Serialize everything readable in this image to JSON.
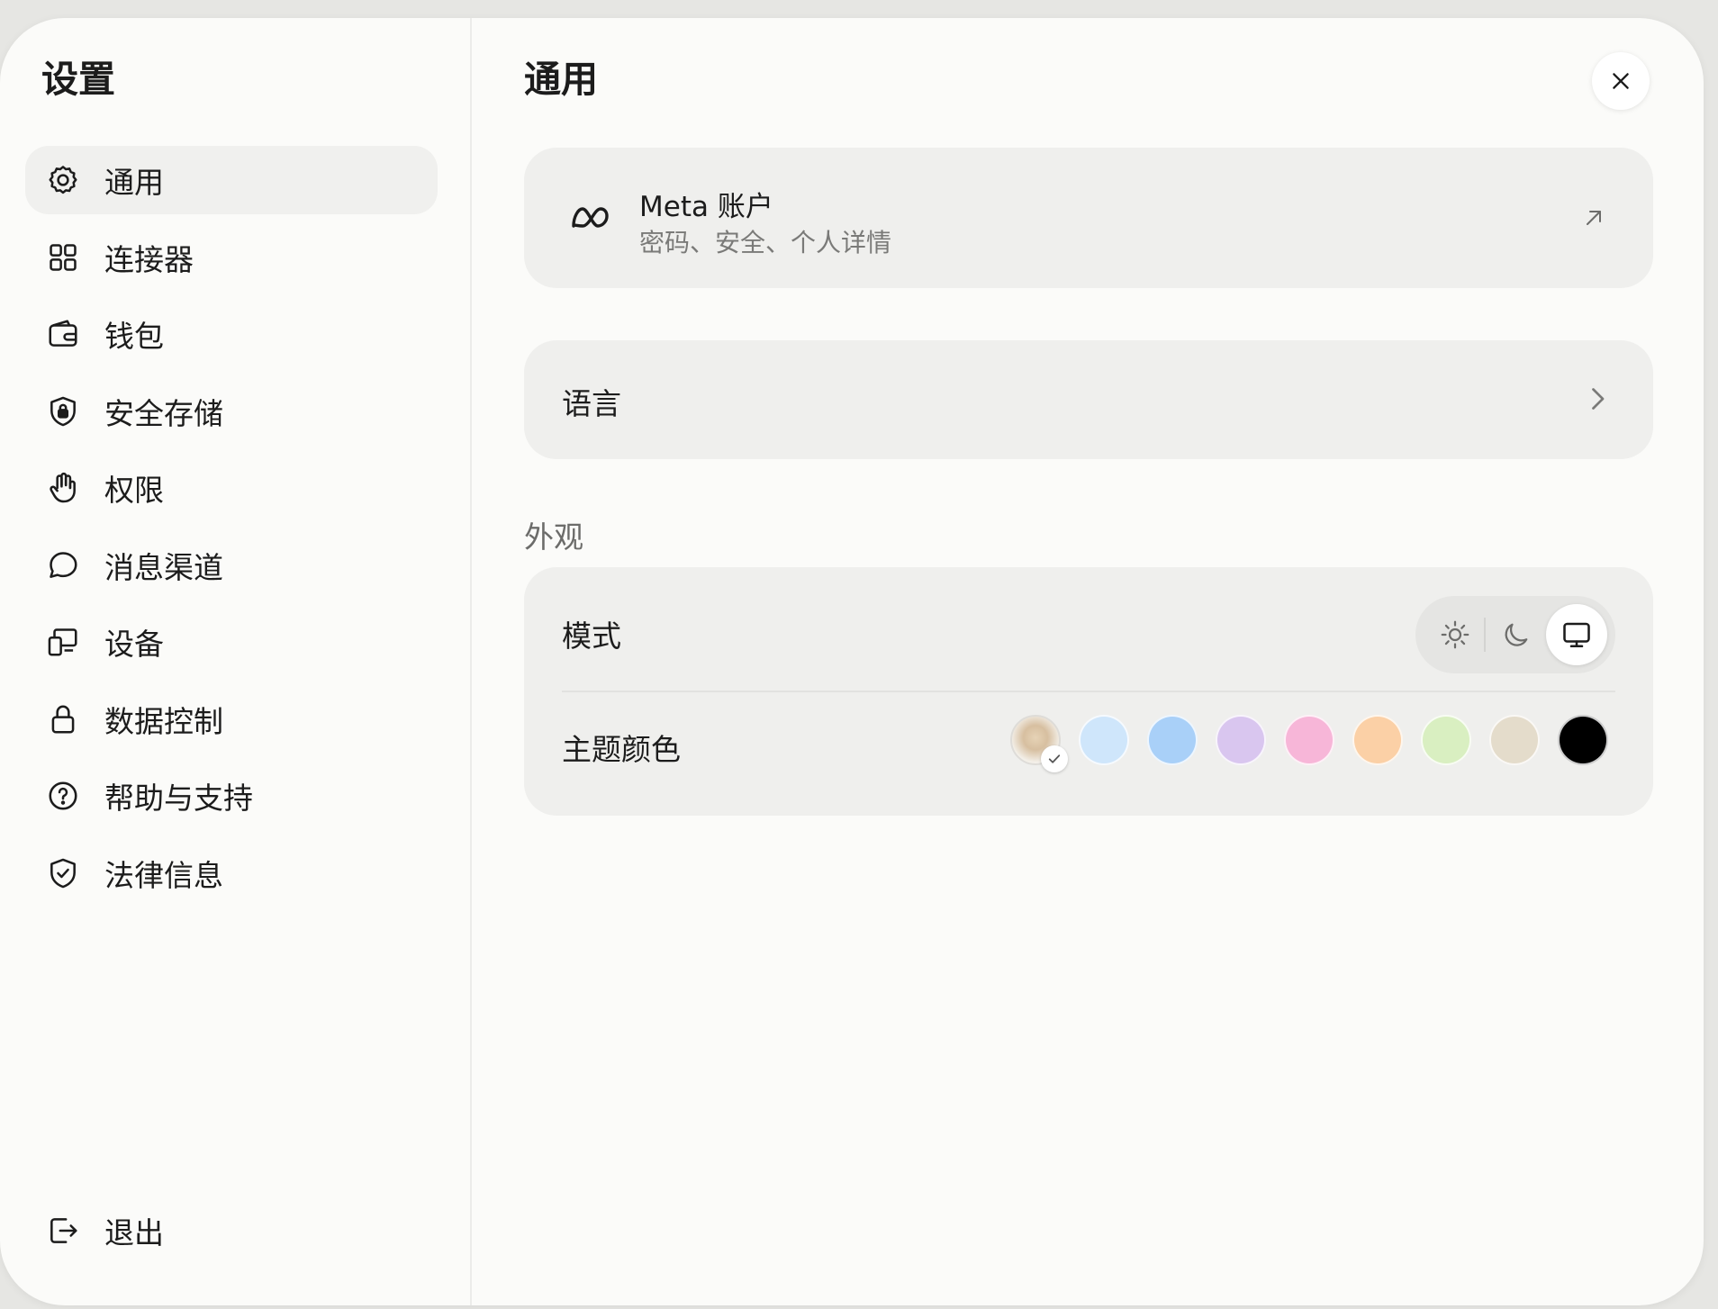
{
  "sidebar": {
    "title": "设置",
    "items": [
      {
        "label": "通用",
        "icon": "gear-icon",
        "active": true
      },
      {
        "label": "连接器",
        "icon": "grid-icon",
        "active": false
      },
      {
        "label": "钱包",
        "icon": "wallet-icon",
        "active": false
      },
      {
        "label": "安全存储",
        "icon": "shield-lock-icon",
        "active": false
      },
      {
        "label": "权限",
        "icon": "hand-icon",
        "active": false
      },
      {
        "label": "消息渠道",
        "icon": "chat-bubble-icon",
        "active": false
      },
      {
        "label": "设备",
        "icon": "devices-icon",
        "active": false
      },
      {
        "label": "数据控制",
        "icon": "lock-icon",
        "active": false
      },
      {
        "label": "帮助与支持",
        "icon": "help-circle-icon",
        "active": false
      },
      {
        "label": "法律信息",
        "icon": "shield-check-icon",
        "active": false
      }
    ],
    "logout_label": "退出"
  },
  "main": {
    "title": "通用",
    "account": {
      "name": "Meta 账户",
      "subtitle": "密码、安全、个人详情"
    },
    "language": {
      "label": "语言"
    },
    "appearance": {
      "section_label": "外观",
      "mode_label": "模式",
      "mode_options": [
        "light",
        "dark",
        "system"
      ],
      "mode_selected": "system",
      "theme_label": "主题颜色",
      "theme_colors": [
        "image",
        "#cfe6fb",
        "#a9d0f8",
        "#d9c6ef",
        "#f7b6d8",
        "#fbd0a6",
        "#d9efc1",
        "#e4dccb",
        "#000000"
      ],
      "theme_selected_index": 0
    }
  },
  "colors": {
    "window_bg": "#fbfbf9",
    "card_bg": "#efefed",
    "active_nav_bg": "#f0f0ee"
  }
}
